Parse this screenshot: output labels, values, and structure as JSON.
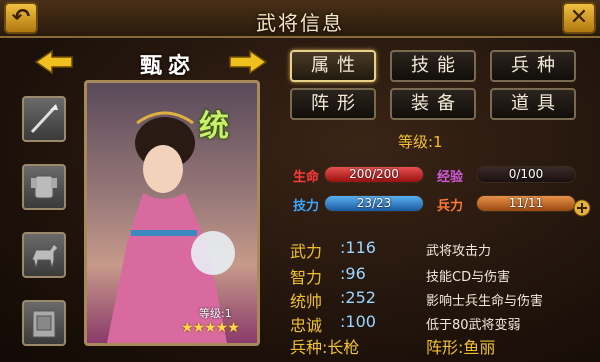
{
  "window": {
    "title": "武将信息"
  },
  "general": {
    "name": "甄宓",
    "badge": "统",
    "card_level": "等级:1",
    "stars": "★★★★★"
  },
  "tabs": [
    {
      "label": "属性",
      "active": true
    },
    {
      "label": "技能"
    },
    {
      "label": "兵种"
    },
    {
      "label": "阵形"
    },
    {
      "label": "装备"
    },
    {
      "label": "道具"
    }
  ],
  "level": "等级:1",
  "stats": {
    "hp": {
      "label": "生命",
      "value": "200/200",
      "fill": 1.0,
      "color": "#c8262a"
    },
    "exp": {
      "label": "经验",
      "value": "0/100",
      "fill": 0.0,
      "color": "#7a2a8a"
    },
    "skill": {
      "label": "技力",
      "value": "23/23",
      "fill": 1.0,
      "color": "#2a86d0"
    },
    "troops": {
      "label": "兵力",
      "value": "11/11",
      "fill": 1.0,
      "color": "#d06a2a"
    }
  },
  "attributes": [
    {
      "name": "武力",
      "value": ":116",
      "desc": "武将攻击力"
    },
    {
      "name": "智力",
      "value": ":96",
      "desc": "技能CD与伤害"
    },
    {
      "name": "统帅",
      "value": ":252",
      "desc": "影响士兵生命与伤害"
    },
    {
      "name": "忠诚",
      "value": ":100",
      "desc": "低于80武将变弱"
    }
  ],
  "bottom": {
    "troop_type": "兵种:长枪",
    "formation": "阵形:鱼丽"
  },
  "equipment_slots": [
    "spear-icon",
    "armor-icon",
    "horse-icon",
    "book-icon"
  ]
}
